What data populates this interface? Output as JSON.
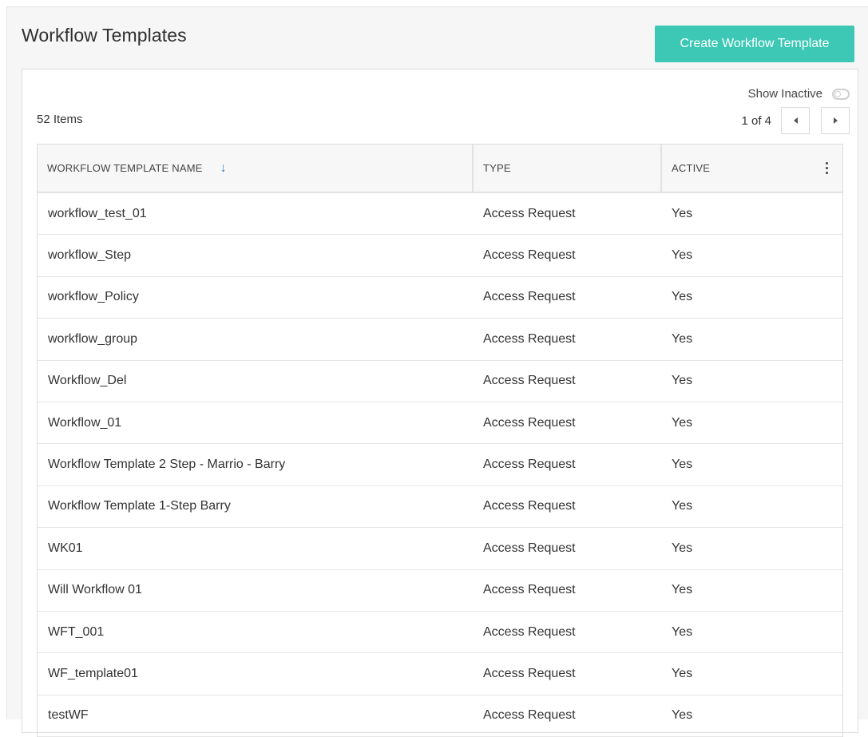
{
  "header": {
    "title": "Workflow Templates",
    "create_button_label": "Create Workflow Template"
  },
  "toolbar": {
    "items_count": "52 Items",
    "show_inactive_label": "Show Inactive",
    "show_inactive_on": false,
    "page_indicator": "1 of 4",
    "prev_icon": "caret-left-icon",
    "next_icon": "caret-right-icon"
  },
  "table": {
    "columns": [
      {
        "label": "WORKFLOW TEMPLATE NAME",
        "sorted": "descending",
        "sort_icon": "arrow-down-icon"
      },
      {
        "label": "TYPE"
      },
      {
        "label": "ACTIVE",
        "menu_icon": "kebab-menu-icon"
      }
    ],
    "rows": [
      {
        "name": "workflow_test_01",
        "type": "Access Request",
        "active": "Yes"
      },
      {
        "name": "workflow_Step",
        "type": "Access Request",
        "active": "Yes"
      },
      {
        "name": "workflow_Policy",
        "type": "Access Request",
        "active": "Yes"
      },
      {
        "name": "workflow_group",
        "type": "Access Request",
        "active": "Yes"
      },
      {
        "name": "Workflow_Del",
        "type": "Access Request",
        "active": "Yes"
      },
      {
        "name": "Workflow_01",
        "type": "Access Request",
        "active": "Yes"
      },
      {
        "name": "Workflow Template 2 Step - Marrio - Barry",
        "type": "Access Request",
        "active": "Yes"
      },
      {
        "name": "Workflow Template 1-Step Barry",
        "type": "Access Request",
        "active": "Yes"
      },
      {
        "name": "WK01",
        "type": "Access Request",
        "active": "Yes"
      },
      {
        "name": "Will Workflow 01",
        "type": "Access Request",
        "active": "Yes"
      },
      {
        "name": "WFT_001",
        "type": "Access Request",
        "active": "Yes"
      },
      {
        "name": "WF_template01",
        "type": "Access Request",
        "active": "Yes"
      },
      {
        "name": "testWF",
        "type": "Access Request",
        "active": "Yes"
      }
    ]
  },
  "colors": {
    "accent": "#3cc8b5",
    "sort_arrow": "#3b82c4"
  }
}
